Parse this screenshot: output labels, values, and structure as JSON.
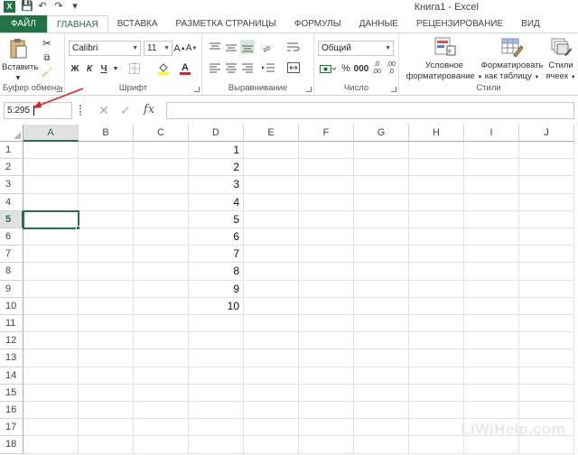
{
  "window": {
    "title": "Книга1 - Excel"
  },
  "tabs": [
    "ФАЙЛ",
    "ГЛАВНАЯ",
    "ВСТАВКА",
    "РАЗМЕТКА СТРАНИЦЫ",
    "ФОРМУЛЫ",
    "ДАННЫЕ",
    "РЕЦЕНЗИРОВАНИЕ",
    "ВИД"
  ],
  "ribbon": {
    "clipboard": {
      "paste_label": "Вставить",
      "group_label": "Буфер обмена"
    },
    "font": {
      "font_name": "Calibri",
      "font_size": "11",
      "bold": "Ж",
      "italic": "К",
      "underline": "Ч",
      "group_label": "Шрифт"
    },
    "alignment": {
      "group_label": "Выравнивание"
    },
    "number": {
      "format": "Общий",
      "group_label": "Число"
    },
    "styles": {
      "conditional_label_1": "Условное",
      "conditional_label_2": "форматирование",
      "table_label_1": "Форматировать",
      "table_label_2": "как таблицу",
      "cell_styles_1": "Стили",
      "cell_styles_2": "ячеек",
      "group_label": "Стили"
    }
  },
  "formula_bar": {
    "name_box": "5:295",
    "fx": "fx"
  },
  "grid": {
    "columns": [
      "A",
      "B",
      "C",
      "D",
      "E",
      "F",
      "G",
      "H",
      "I",
      "J"
    ],
    "rows": [
      "1",
      "2",
      "3",
      "4",
      "5",
      "6",
      "7",
      "8",
      "9",
      "10",
      "11",
      "12",
      "13",
      "14",
      "15",
      "16",
      "17",
      "18"
    ],
    "selected_row": "5",
    "selected_column": "A",
    "column_D_values": [
      "1",
      "2",
      "3",
      "4",
      "5",
      "6",
      "7",
      "8",
      "9",
      "10"
    ]
  },
  "watermark": "LiWiHelp.com",
  "colors": {
    "accent": "#217346",
    "annotation": "#e02020"
  }
}
